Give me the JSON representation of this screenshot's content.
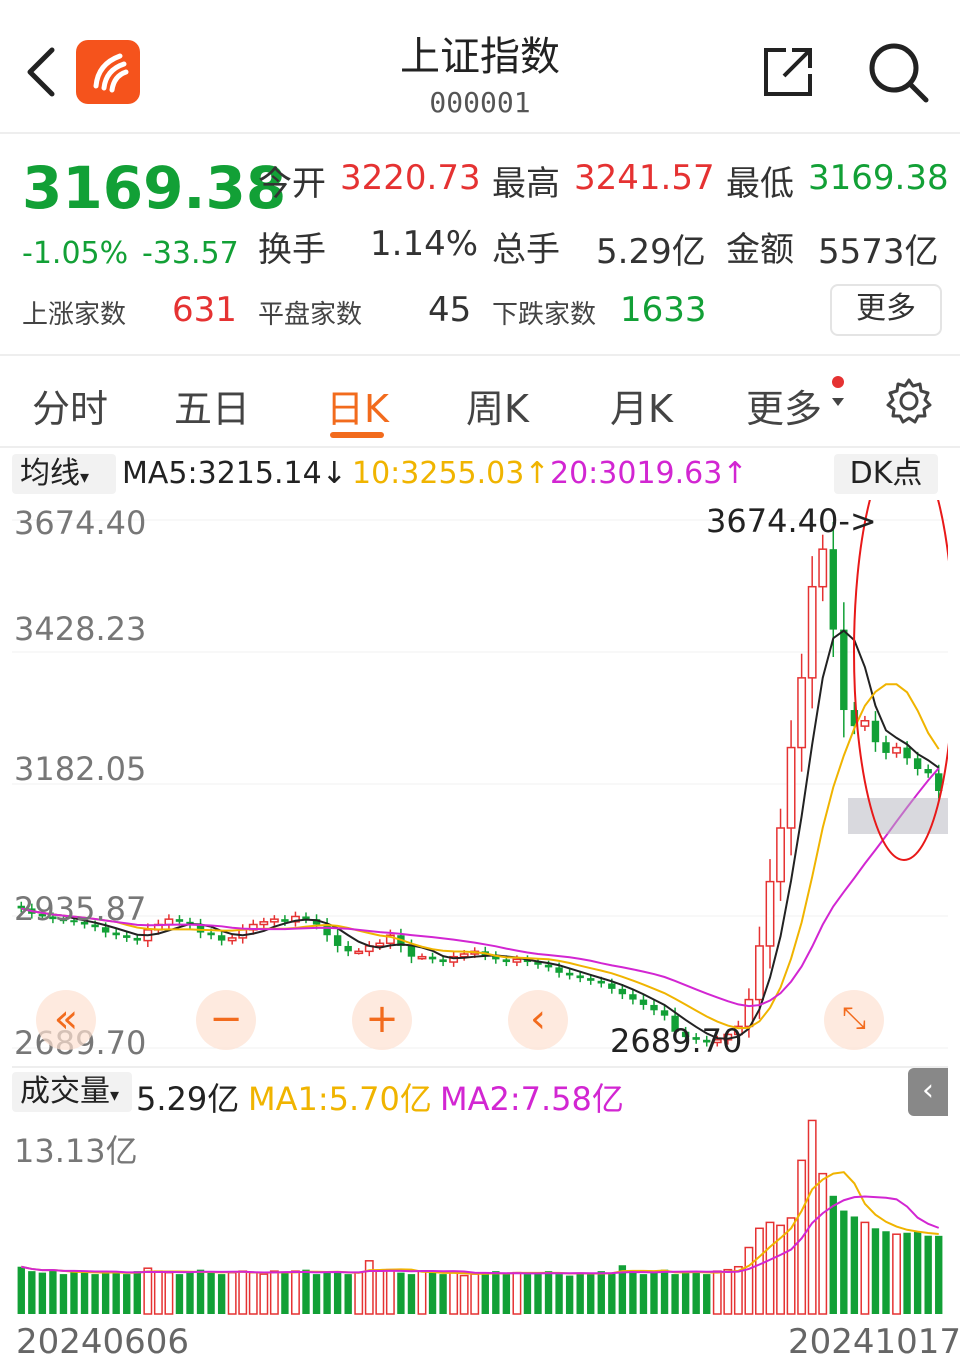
{
  "header": {
    "title": "上证指数",
    "code": "000001",
    "back_icon": "chevron-left-icon",
    "share_icon": "share-external-icon",
    "search_icon": "search-icon"
  },
  "quote": {
    "price": "3169.38",
    "change_pct": "-1.05%",
    "change_abs": "-33.57",
    "open_label": "今开",
    "open": "3220.73",
    "high_label": "最高",
    "high": "3241.57",
    "low_label": "最低",
    "low": "3169.38",
    "turnover_label": "换手",
    "turnover": "1.14%",
    "volume_label": "总手",
    "volume": "5.29亿",
    "amount_label": "金额",
    "amount": "5573亿",
    "up_label": "上涨家数",
    "up_count": "631",
    "flat_label": "平盘家数",
    "flat_count": "45",
    "down_label": "下跌家数",
    "down_count": "1633",
    "more_label": "更多"
  },
  "tabs": [
    "分时",
    "五日",
    "日K",
    "周K",
    "月K",
    "更多"
  ],
  "active_tab": "日K",
  "ma": {
    "selector": "均线",
    "ma5": "MA5:3215.14↓",
    "ma10": "10:3255.03↑",
    "ma20": "20:3019.63↑",
    "dk": "DK点"
  },
  "price_axis": [
    "3674.40",
    "3428.23",
    "3182.05",
    "2935.87",
    "2689.70"
  ],
  "annotations": {
    "high_mark": "3674.40->",
    "low_mark": "2689.70"
  },
  "volume": {
    "selector": "成交量",
    "value": "5.29亿",
    "ma1": "MA1:5.70亿",
    "ma2": "MA2:7.58亿",
    "axis_top": "13.13亿"
  },
  "dates": {
    "start": "20240606",
    "end": "20241017"
  },
  "colors": {
    "up": "#e53232",
    "down": "#12a036",
    "accent": "#f26b1d",
    "ma5": "#222222",
    "ma10": "#f0b400",
    "ma20": "#d226d2"
  },
  "chart_data": {
    "type": "candlestick",
    "ylim": [
      2689.7,
      3674.4
    ],
    "high": 3674.4,
    "low": 2689.7,
    "closes": [
      2950,
      2940,
      2935,
      2930,
      2928,
      2925,
      2920,
      2915,
      2905,
      2900,
      2895,
      2890,
      2910,
      2920,
      2930,
      2925,
      2920,
      2905,
      2900,
      2890,
      2895,
      2910,
      2920,
      2925,
      2930,
      2925,
      2935,
      2930,
      2920,
      2900,
      2880,
      2870,
      2870,
      2880,
      2885,
      2900,
      2880,
      2860,
      2860,
      2855,
      2850,
      2860,
      2865,
      2870,
      2862,
      2855,
      2850,
      2855,
      2850,
      2845,
      2840,
      2830,
      2825,
      2820,
      2815,
      2810,
      2800,
      2790,
      2780,
      2770,
      2760,
      2750,
      2720,
      2710,
      2705,
      2700,
      2705,
      2715,
      2730,
      2780,
      2880,
      3000,
      3100,
      3250,
      3380,
      3550,
      3620,
      3470,
      3320,
      3290,
      3300,
      3260,
      3240,
      3250,
      3230,
      3210,
      3202,
      3169
    ],
    "volumes": [
      3.2,
      2.9,
      2.8,
      3.0,
      2.7,
      2.9,
      2.8,
      2.7,
      2.9,
      2.8,
      2.7,
      2.9,
      3.1,
      2.9,
      2.8,
      2.7,
      2.8,
      3.0,
      2.9,
      2.7,
      2.8,
      2.9,
      2.8,
      2.7,
      2.9,
      2.8,
      2.9,
      3.0,
      2.7,
      2.8,
      2.9,
      2.7,
      2.8,
      3.6,
      2.9,
      3.0,
      2.8,
      2.7,
      2.9,
      2.8,
      2.7,
      2.8,
      2.6,
      2.7,
      2.8,
      2.9,
      2.7,
      2.8,
      2.7,
      2.8,
      2.9,
      2.7,
      2.6,
      2.8,
      2.7,
      2.9,
      2.8,
      3.3,
      2.9,
      2.7,
      2.8,
      3.0,
      2.7,
      2.9,
      2.8,
      2.7,
      2.9,
      3.0,
      3.2,
      4.5,
      5.8,
      6.2,
      6.0,
      6.5,
      10.4,
      13.1,
      9.5,
      8.0,
      7.0,
      6.6,
      6.2,
      5.8,
      5.6,
      5.4,
      5.5,
      5.6,
      5.3,
      5.29
    ]
  }
}
